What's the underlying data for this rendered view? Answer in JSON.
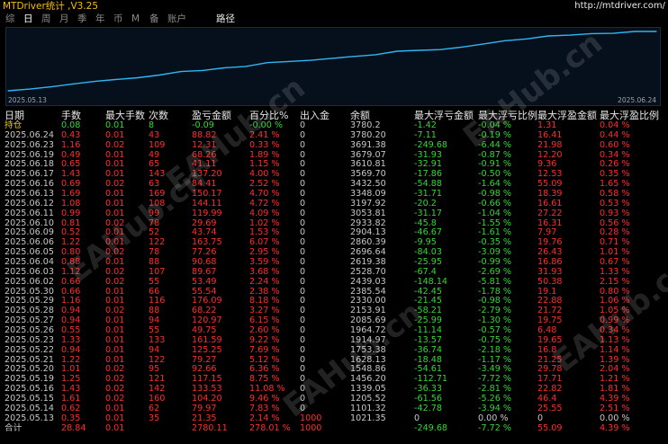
{
  "app": {
    "title": "MTDriver统计 ,V3.25",
    "url": "http://mtdriver.com/"
  },
  "tabs": [
    {
      "label": "综",
      "active": false
    },
    {
      "label": "日",
      "active": true
    },
    {
      "label": "周",
      "active": false
    },
    {
      "label": "月",
      "active": false
    },
    {
      "label": "季",
      "active": false
    },
    {
      "label": "年",
      "active": false
    },
    {
      "label": "币",
      "active": false
    },
    {
      "label": "M",
      "active": false
    },
    {
      "label": "备",
      "active": false
    },
    {
      "label": "账户",
      "active": false
    },
    {
      "label": "路径",
      "active": false
    }
  ],
  "chart_data": {
    "type": "line",
    "x_start_label": "2025.05.13",
    "x_end_label": "2025.06.24",
    "x": [
      "2025.05.13",
      "2025.05.14",
      "2025.05.15",
      "2025.05.16",
      "2025.05.19",
      "2025.05.20",
      "2025.05.21",
      "2025.05.22",
      "2025.05.23",
      "2025.05.26",
      "2025.05.27",
      "2025.05.28",
      "2025.05.29",
      "2025.05.30",
      "2025.06.02",
      "2025.06.03",
      "2025.06.04",
      "2025.06.05",
      "2025.06.06",
      "2025.06.09",
      "2025.06.10",
      "2025.06.11",
      "2025.06.12",
      "2025.06.13",
      "2025.06.16",
      "2025.06.17",
      "2025.06.18",
      "2025.06.19",
      "2025.06.20",
      "2025.06.23",
      "2025.06.24"
    ],
    "series": [
      {
        "values": [
          1021.35,
          1101.32,
          1205.52,
          1339.05,
          1456.2,
          1548.86,
          1628.13,
          1753.38,
          1914.97,
          1964.72,
          2085.69,
          2153.91,
          2330.0,
          2385.54,
          2439.03,
          2528.7,
          2619.38,
          2696.64,
          2860.39,
          2904.13,
          2933.82,
          3053.81,
          3197.92,
          3348.09,
          3432.5,
          3569.7,
          3610.81,
          3679.07,
          3691.38,
          3780.2,
          3780.2
        ]
      }
    ],
    "color": "#2fb6f0"
  },
  "table": {
    "headers": [
      "日期",
      "手数",
      "最大手数",
      "次数",
      "盈亏金额",
      "百分比%",
      "出入金",
      "余额",
      "最大浮亏金额",
      "最大浮亏比例",
      "最大浮盈金额",
      "最大浮盈比例"
    ],
    "rows": [
      {
        "c": [
          "持仓",
          "0.08",
          "0.01",
          "8",
          "-0.09",
          "-0.00 %",
          "0",
          "3780.2",
          "-1.42",
          "-0.04 %",
          "1.31",
          "0.04 %"
        ],
        "k": [
          "y",
          "g",
          "g",
          "g",
          "g",
          "g",
          "w",
          "w",
          "g",
          "g",
          "r",
          "r"
        ]
      },
      {
        "c": [
          "2025.06.24",
          "0.43",
          "0.01",
          "43",
          "88.82",
          "2.41 %",
          "0",
          "3780.20",
          "-7.11",
          "-0.19 %",
          "16.41",
          "0.44 %"
        ],
        "k": [
          "w",
          "r",
          "r",
          "r",
          "r",
          "r",
          "w",
          "w",
          "g",
          "g",
          "r",
          "r"
        ]
      },
      {
        "c": [
          "2025.06.23",
          "1.16",
          "0.02",
          "109",
          "12.31",
          "0.33 %",
          "0",
          "3691.38",
          "-249.68",
          "-6.44 %",
          "21.98",
          "0.60 %"
        ],
        "k": [
          "w",
          "r",
          "r",
          "r",
          "r",
          "r",
          "w",
          "w",
          "g",
          "g",
          "r",
          "r"
        ]
      },
      {
        "c": [
          "2025.06.19",
          "0.49",
          "0.01",
          "49",
          "68.26",
          "1.89 %",
          "0",
          "3679.07",
          "-31.93",
          "-0.87 %",
          "12.20",
          "0.34 %"
        ],
        "k": [
          "w",
          "r",
          "r",
          "r",
          "r",
          "r",
          "w",
          "w",
          "g",
          "g",
          "r",
          "r"
        ]
      },
      {
        "c": [
          "2025.06.18",
          "0.65",
          "0.01",
          "65",
          "41.11",
          "1.15 %",
          "0",
          "3610.81",
          "-32.91",
          "-0.91 %",
          "9.36",
          "0.26 %"
        ],
        "k": [
          "w",
          "r",
          "r",
          "r",
          "r",
          "r",
          "w",
          "w",
          "g",
          "g",
          "r",
          "r"
        ]
      },
      {
        "c": [
          "2025.06.17",
          "1.43",
          "0.01",
          "143",
          "137.20",
          "4.00 %",
          "0",
          "3569.70",
          "-17.86",
          "-0.50 %",
          "12.53",
          "0.35 %"
        ],
        "k": [
          "w",
          "r",
          "r",
          "r",
          "r",
          "r",
          "w",
          "w",
          "g",
          "g",
          "r",
          "r"
        ]
      },
      {
        "c": [
          "2025.06.16",
          "0.69",
          "0.02",
          "63",
          "84.41",
          "2.52 %",
          "0",
          "3432.50",
          "-54.88",
          "-1.64 %",
          "55.09",
          "1.65 %"
        ],
        "k": [
          "w",
          "r",
          "r",
          "r",
          "r",
          "r",
          "w",
          "w",
          "g",
          "g",
          "r",
          "r"
        ]
      },
      {
        "c": [
          "2025.06.13",
          "1.69",
          "0.01",
          "169",
          "150.17",
          "4.70 %",
          "0",
          "3348.09",
          "-31.71",
          "-0.98 %",
          "18.39",
          "0.58 %"
        ],
        "k": [
          "w",
          "r",
          "r",
          "r",
          "r",
          "r",
          "w",
          "w",
          "g",
          "g",
          "r",
          "r"
        ]
      },
      {
        "c": [
          "2025.06.12",
          "1.08",
          "0.01",
          "108",
          "144.11",
          "4.72 %",
          "0",
          "3197.92",
          "-20.2",
          "-0.66 %",
          "16.61",
          "0.53 %"
        ],
        "k": [
          "w",
          "r",
          "r",
          "r",
          "r",
          "r",
          "w",
          "w",
          "g",
          "g",
          "r",
          "r"
        ]
      },
      {
        "c": [
          "2025.06.11",
          "0.99",
          "0.01",
          "99",
          "119.99",
          "4.09 %",
          "0",
          "3053.81",
          "-31.17",
          "-1.04 %",
          "27.22",
          "0.93 %"
        ],
        "k": [
          "w",
          "r",
          "r",
          "r",
          "r",
          "r",
          "w",
          "w",
          "g",
          "g",
          "r",
          "r"
        ]
      },
      {
        "c": [
          "2025.06.10",
          "0.81",
          "0.02",
          "78",
          "29.69",
          "1.02 %",
          "0",
          "2933.82",
          "-45.8",
          "-1.55 %",
          "16.31",
          "0.56 %"
        ],
        "k": [
          "w",
          "r",
          "r",
          "r",
          "r",
          "r",
          "w",
          "w",
          "g",
          "g",
          "r",
          "r"
        ]
      },
      {
        "c": [
          "2025.06.09",
          "0.52",
          "0.01",
          "52",
          "43.74",
          "1.53 %",
          "0",
          "2904.13",
          "-46.67",
          "-1.61 %",
          "7.97",
          "0.28 %"
        ],
        "k": [
          "w",
          "r",
          "r",
          "r",
          "r",
          "r",
          "w",
          "w",
          "g",
          "g",
          "r",
          "r"
        ]
      },
      {
        "c": [
          "2025.06.06",
          "1.22",
          "0.01",
          "122",
          "163.75",
          "6.07 %",
          "0",
          "2860.39",
          "-9.95",
          "-0.35 %",
          "19.76",
          "0.71 %"
        ],
        "k": [
          "w",
          "r",
          "r",
          "r",
          "r",
          "r",
          "w",
          "w",
          "g",
          "g",
          "r",
          "r"
        ]
      },
      {
        "c": [
          "2025.06.05",
          "0.80",
          "0.02",
          "78",
          "77.26",
          "2.95 %",
          "0",
          "2696.64",
          "-84.03",
          "-3.09 %",
          "26.43",
          "1.01 %"
        ],
        "k": [
          "w",
          "r",
          "r",
          "r",
          "r",
          "r",
          "w",
          "w",
          "g",
          "g",
          "r",
          "r"
        ]
      },
      {
        "c": [
          "2025.06.04",
          "0.88",
          "0.01",
          "88",
          "90.68",
          "3.59 %",
          "0",
          "2619.38",
          "-25.95",
          "-0.99 %",
          "16.86",
          "0.67 %"
        ],
        "k": [
          "w",
          "r",
          "r",
          "r",
          "r",
          "r",
          "w",
          "w",
          "g",
          "g",
          "r",
          "r"
        ]
      },
      {
        "c": [
          "2025.06.03",
          "1.12",
          "0.02",
          "107",
          "89.67",
          "3.68 %",
          "0",
          "2528.70",
          "-67.4",
          "-2.69 %",
          "31.93",
          "1.33 %"
        ],
        "k": [
          "w",
          "r",
          "r",
          "r",
          "r",
          "r",
          "w",
          "w",
          "g",
          "g",
          "r",
          "r"
        ]
      },
      {
        "c": [
          "2025.06.02",
          "0.66",
          "0.02",
          "55",
          "53.49",
          "2.24 %",
          "0",
          "2439.03",
          "-148.14",
          "-5.81 %",
          "50.38",
          "2.15 %"
        ],
        "k": [
          "w",
          "r",
          "r",
          "r",
          "r",
          "r",
          "w",
          "w",
          "g",
          "g",
          "r",
          "r"
        ]
      },
      {
        "c": [
          "2025.05.30",
          "0.66",
          "0.01",
          "66",
          "55.54",
          "2.38 %",
          "0",
          "2385.54",
          "-42.45",
          "-1.78 %",
          "19.1",
          "0.80 %"
        ],
        "k": [
          "w",
          "r",
          "r",
          "r",
          "r",
          "r",
          "w",
          "w",
          "g",
          "g",
          "r",
          "r"
        ]
      },
      {
        "c": [
          "2025.05.29",
          "1.16",
          "0.01",
          "116",
          "176.09",
          "8.18 %",
          "0",
          "2330.00",
          "-21.45",
          "-0.98 %",
          "22.88",
          "1.06 %"
        ],
        "k": [
          "w",
          "r",
          "r",
          "r",
          "r",
          "r",
          "w",
          "w",
          "g",
          "g",
          "r",
          "r"
        ]
      },
      {
        "c": [
          "2025.05.28",
          "0.94",
          "0.02",
          "88",
          "68.22",
          "3.27 %",
          "0",
          "2153.91",
          "-58.21",
          "-2.79 %",
          "21.72",
          "1.05 %"
        ],
        "k": [
          "w",
          "r",
          "r",
          "r",
          "r",
          "r",
          "w",
          "w",
          "g",
          "g",
          "r",
          "r"
        ]
      },
      {
        "c": [
          "2025.05.27",
          "0.94",
          "0.01",
          "94",
          "120.97",
          "6.15 %",
          "0",
          "2085.69",
          "-25.99",
          "-1.30 %",
          "19.75",
          "0.99 %"
        ],
        "k": [
          "w",
          "r",
          "r",
          "r",
          "r",
          "r",
          "w",
          "w",
          "g",
          "g",
          "r",
          "r"
        ]
      },
      {
        "c": [
          "2025.05.26",
          "0.55",
          "0.01",
          "55",
          "49.75",
          "2.60 %",
          "0",
          "1964.72",
          "-11.14",
          "-0.57 %",
          "6.48",
          "0.34 %"
        ],
        "k": [
          "w",
          "r",
          "r",
          "r",
          "r",
          "r",
          "w",
          "w",
          "g",
          "g",
          "r",
          "r"
        ]
      },
      {
        "c": [
          "2025.05.23",
          "1.33",
          "0.01",
          "133",
          "161.59",
          "9.22 %",
          "0",
          "1914.97",
          "-13.57",
          "-0.75 %",
          "19.65",
          "1.13 %"
        ],
        "k": [
          "w",
          "r",
          "r",
          "r",
          "r",
          "r",
          "w",
          "w",
          "g",
          "g",
          "r",
          "r"
        ]
      },
      {
        "c": [
          "2025.05.22",
          "0.94",
          "0.01",
          "94",
          "125.25",
          "7.69 %",
          "0",
          "1753.38",
          "-36.74",
          "-2.18 %",
          "16.8",
          "1.14 %"
        ],
        "k": [
          "w",
          "r",
          "r",
          "r",
          "r",
          "r",
          "w",
          "w",
          "g",
          "g",
          "r",
          "r"
        ]
      },
      {
        "c": [
          "2025.05.21",
          "1.22",
          "0.01",
          "122",
          "79.27",
          "5.12 %",
          "0",
          "1628.13",
          "-18.48",
          "-1.17 %",
          "21.25",
          "1.39 %"
        ],
        "k": [
          "w",
          "r",
          "r",
          "r",
          "r",
          "r",
          "w",
          "w",
          "g",
          "g",
          "r",
          "r"
        ]
      },
      {
        "c": [
          "2025.05.20",
          "1.01",
          "0.02",
          "95",
          "92.66",
          "6.36 %",
          "0",
          "1548.86",
          "-54.61",
          "-3.49 %",
          "29.78",
          "2.04 %"
        ],
        "k": [
          "w",
          "r",
          "r",
          "r",
          "r",
          "r",
          "w",
          "w",
          "g",
          "g",
          "r",
          "r"
        ]
      },
      {
        "c": [
          "2025.05.19",
          "1.25",
          "0.02",
          "121",
          "117.15",
          "8.75 %",
          "0",
          "1456.20",
          "-112.71",
          "-7.72 %",
          "17.71",
          "1.21 %"
        ],
        "k": [
          "w",
          "r",
          "r",
          "r",
          "r",
          "r",
          "w",
          "w",
          "g",
          "g",
          "r",
          "r"
        ]
      },
      {
        "c": [
          "2025.05.16",
          "1.43",
          "0.02",
          "142",
          "133.53",
          "11.08 %",
          "0",
          "1339.05",
          "-36.33",
          "-2.81 %",
          "22.82",
          "1.81 %"
        ],
        "k": [
          "w",
          "r",
          "r",
          "r",
          "r",
          "r",
          "w",
          "w",
          "g",
          "g",
          "r",
          "r"
        ]
      },
      {
        "c": [
          "2025.05.15",
          "1.61",
          "0.02",
          "160",
          "104.20",
          "9.46 %",
          "0",
          "1205.52",
          "-61.56",
          "-5.26 %",
          "46.4",
          "4.39 %"
        ],
        "k": [
          "w",
          "r",
          "r",
          "r",
          "r",
          "r",
          "w",
          "w",
          "g",
          "g",
          "r",
          "r"
        ]
      },
      {
        "c": [
          "2025.05.14",
          "0.62",
          "0.01",
          "62",
          "79.97",
          "7.83 %",
          "0",
          "1101.32",
          "-42.78",
          "-3.94 %",
          "25.55",
          "2.51 %"
        ],
        "k": [
          "w",
          "r",
          "r",
          "r",
          "r",
          "r",
          "w",
          "w",
          "g",
          "g",
          "r",
          "r"
        ]
      },
      {
        "c": [
          "2025.05.13",
          "0.35",
          "0.01",
          "35",
          "21.35",
          "2.14 %",
          "1000",
          "1021.35",
          "0",
          "0.00 %",
          "0",
          "0.00 %"
        ],
        "k": [
          "w",
          "r",
          "r",
          "r",
          "r",
          "r",
          "r",
          "w",
          "w",
          "w",
          "w",
          "w"
        ]
      },
      {
        "c": [
          "合计",
          "28.84",
          "0.01",
          "",
          "2780.11",
          "278.01 %",
          "1000",
          "",
          "-249.68",
          "-7.72 %",
          "55.09",
          "4.39 %"
        ],
        "k": [
          "w",
          "r",
          "r",
          "r",
          "r",
          "r",
          "r",
          "w",
          "g",
          "g",
          "r",
          "r"
        ]
      }
    ]
  },
  "watermark": {
    "text": "EAHub.cn"
  }
}
